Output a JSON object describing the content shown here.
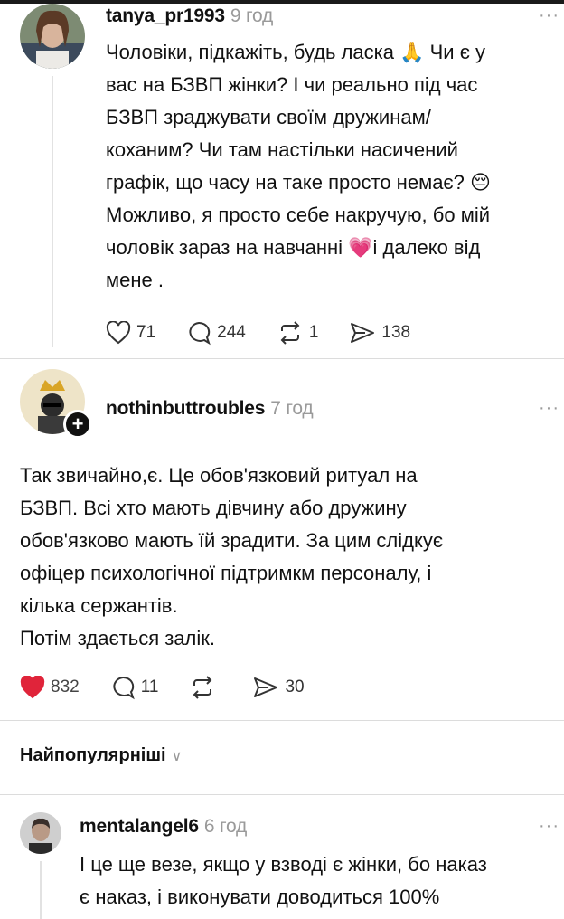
{
  "posts": [
    {
      "username": "tanya_pr1993",
      "time": "9 год",
      "text_lines": [
        "Чоловіки, підкажіть, будь ласка 🙏 Чи є у",
        "вас на БЗВП жінки? І чи реально під час",
        "БЗВП зраджувати своїм дружинам/",
        "коханим? Чи там настільки насичений",
        "графік, що часу на таке просто немає? 😔",
        "Можливо, я просто себе накручую, бо мій",
        "чоловік зараз на навчанні 💗і далеко від",
        "мене ."
      ],
      "likes": "71",
      "comments": "244",
      "reposts": "1",
      "shares": "138"
    },
    {
      "username": "nothinbuttroubles",
      "time": "7 год",
      "text_lines": [
        "Так звичайно,є. Це обов'язковий ритуал на",
        "БЗВП. Всі хто мають дівчину або дружину",
        "обов'язково мають їй зрадити. За цим слідкує",
        "офіцер психологічної підтримкм персоналу, і",
        "кілька сержантів.",
        "Потім здається залік."
      ],
      "likes": "832",
      "comments": "11",
      "shares": "30"
    }
  ],
  "sort_label": "Найпопулярніші",
  "reply": {
    "username": "mentalangel6",
    "time": "6 год",
    "text_lines": [
      "І це ще везе, якщо у взводі є жінки, бо наказ",
      "є наказ, і виконувати доводиться 100%"
    ]
  },
  "more_label": "···",
  "plus_label": "+",
  "chevron_label": "∨",
  "colors": {
    "liked": "#e0243a",
    "muted": "#9a9a9a"
  }
}
